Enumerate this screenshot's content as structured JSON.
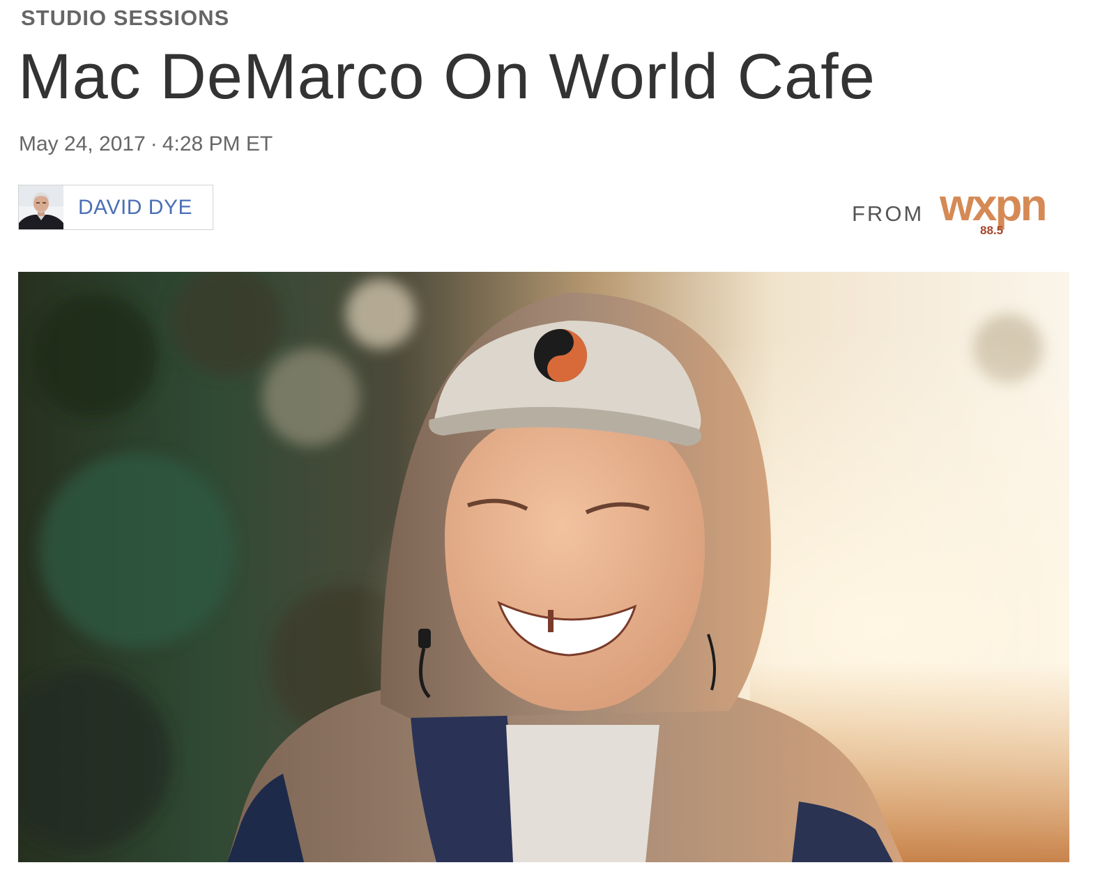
{
  "article": {
    "slug": "STUDIO SESSIONS",
    "title": "Mac DeMarco On World Cafe",
    "date": "May 24, 2017",
    "date_separator": "·",
    "time": "4:28 PM ET"
  },
  "byline": {
    "author_name": "DAVID DYE"
  },
  "station": {
    "from_label": "FROM",
    "logo_text": "wxpn",
    "logo_frequency": "88.5",
    "logo_color": "#d58a56",
    "logo_freq_color": "#a6452a"
  },
  "colors": {
    "title": "#333333",
    "meta_gray": "#666666",
    "author_link": "#4a6fb6"
  }
}
